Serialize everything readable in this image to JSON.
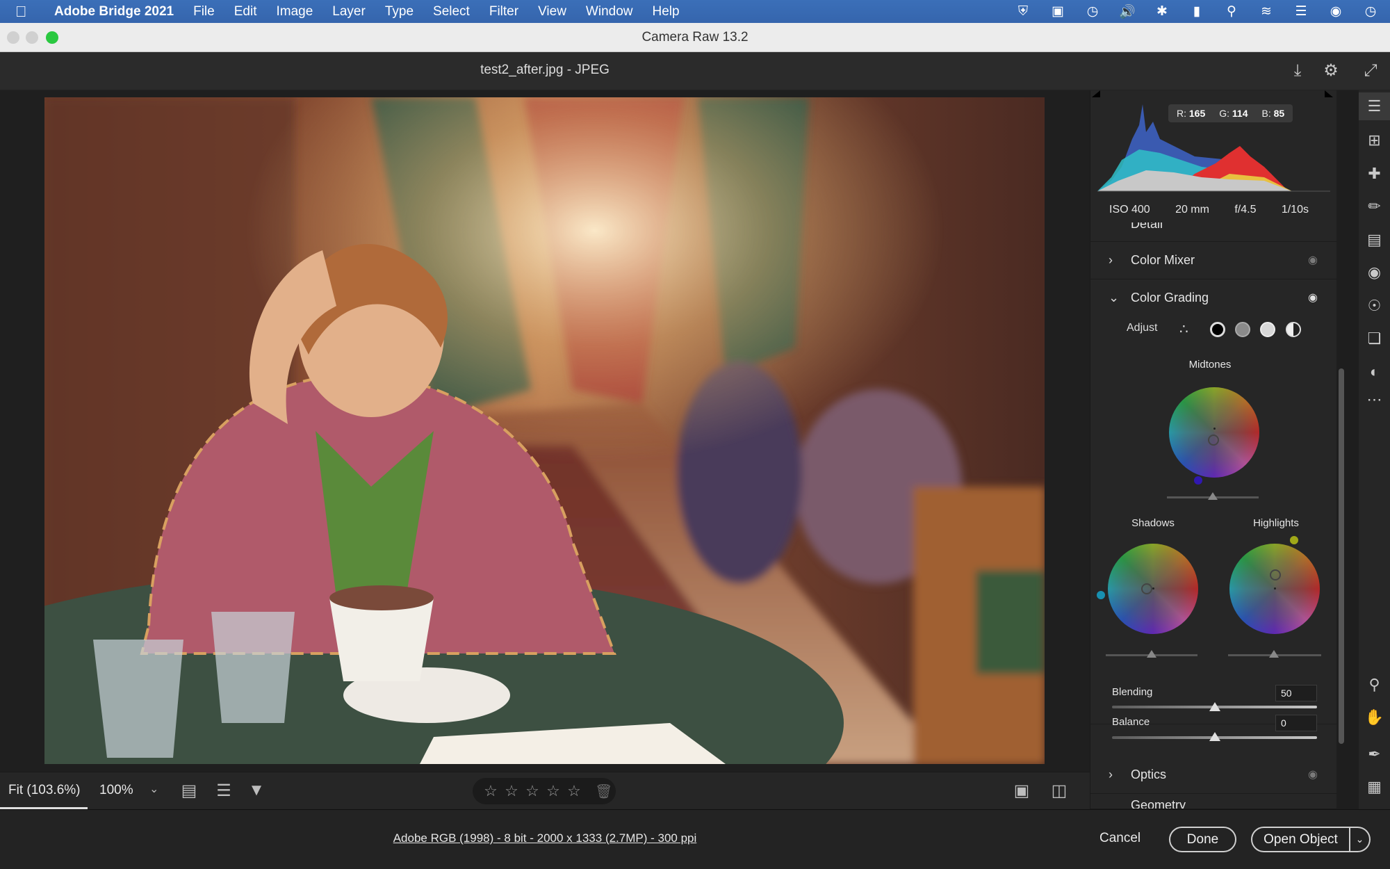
{
  "menubar": {
    "app_name": "Adobe Bridge 2021",
    "menus": [
      "File",
      "Edit",
      "Image",
      "Layer",
      "Type",
      "Select",
      "Filter",
      "View",
      "Window",
      "Help"
    ],
    "status_icons": [
      "shield-icon",
      "cast-icon",
      "time-machine-icon",
      "volume-icon",
      "bluetooth-icon",
      "battery-icon",
      "spotlight-icon",
      "wifi-icon",
      "control-center-icon",
      "siri-icon",
      "clock-icon"
    ]
  },
  "window": {
    "title": "Camera Raw 13.2"
  },
  "header": {
    "filename": "test2_after.jpg  -  JPEG"
  },
  "histogram": {
    "r_label": "R:",
    "r_value": "165",
    "g_label": "G:",
    "g_value": "114",
    "b_label": "B:",
    "b_value": "85",
    "exif": [
      "ISO 400",
      "20 mm",
      "f/4.5",
      "1/10s"
    ]
  },
  "panels": {
    "partial_label": "Detail",
    "color_mixer": "Color Mixer",
    "color_grading": "Color Grading",
    "optics": "Optics",
    "geometry_partial": "Geometry"
  },
  "grading": {
    "adjust_label": "Adjust",
    "midtones_label": "Midtones",
    "shadows_label": "Shadows",
    "highlights_label": "Highlights",
    "blending_label": "Blending",
    "blending_value": "50",
    "balance_label": "Balance",
    "balance_value": "0",
    "blending_fraction": 0.5,
    "balance_fraction": 0.5
  },
  "bottombar": {
    "zoom_fit": "Fit (103.6%)",
    "zoom_100": "100%",
    "rating_stars": 0
  },
  "footer": {
    "workflow": "Adobe RGB (1998) - 8 bit - 2000 x 1333 (2.7MP) - 300 ppi",
    "cancel": "Cancel",
    "done": "Done",
    "open_object": "Open Object"
  },
  "tools": [
    "edit-sliders-icon",
    "crop-icon",
    "healing-icon",
    "brush-icon",
    "linear-gradient-icon",
    "radial-gradient-icon",
    "red-eye-icon",
    "snapshots-icon",
    "presets-icon",
    "more-icon",
    "zoom-icon",
    "hand-icon",
    "color-sampler-icon",
    "grid-icon"
  ],
  "colors": {
    "menubar": "#3565ad",
    "panel_bg": "#262626",
    "canvas_bg": "#1f1f1f"
  }
}
